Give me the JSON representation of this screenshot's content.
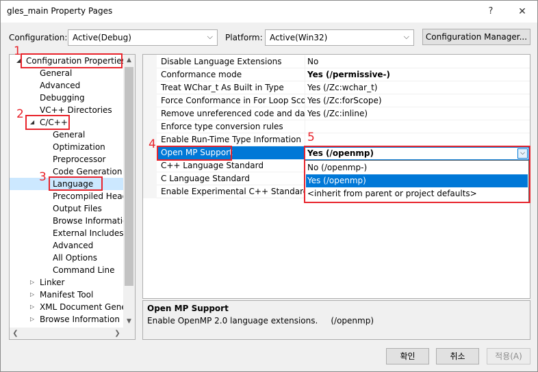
{
  "window": {
    "title": "gles_main Property Pages",
    "help": "?",
    "close": "✕"
  },
  "config_bar": {
    "configuration_label": "Configuration:",
    "configuration_value": "Active(Debug)",
    "platform_label": "Platform:",
    "platform_value": "Active(Win32)",
    "manager_button": "Configuration Manager..."
  },
  "tree": {
    "items": [
      {
        "label": "Configuration Properties",
        "level": 0,
        "expander": "expanded"
      },
      {
        "label": "General",
        "level": 1
      },
      {
        "label": "Advanced",
        "level": 1
      },
      {
        "label": "Debugging",
        "level": 1
      },
      {
        "label": "VC++ Directories",
        "level": 1
      },
      {
        "label": "C/C++",
        "level": 1,
        "expander": "expanded"
      },
      {
        "label": "General",
        "level": 2
      },
      {
        "label": "Optimization",
        "level": 2
      },
      {
        "label": "Preprocessor",
        "level": 2
      },
      {
        "label": "Code Generation",
        "level": 2
      },
      {
        "label": "Language",
        "level": 2,
        "selected": true
      },
      {
        "label": "Precompiled Heade",
        "level": 2
      },
      {
        "label": "Output Files",
        "level": 2
      },
      {
        "label": "Browse Informatior",
        "level": 2
      },
      {
        "label": "External Includes",
        "level": 2
      },
      {
        "label": "Advanced",
        "level": 2
      },
      {
        "label": "All Options",
        "level": 2
      },
      {
        "label": "Command Line",
        "level": 2
      },
      {
        "label": "Linker",
        "level": 1,
        "expander": "collapsed"
      },
      {
        "label": "Manifest Tool",
        "level": 1,
        "expander": "collapsed"
      },
      {
        "label": "XML Document Genera",
        "level": 1,
        "expander": "collapsed"
      },
      {
        "label": "Browse Information",
        "level": 1,
        "expander": "collapsed"
      }
    ]
  },
  "properties": {
    "rows": [
      {
        "name": "Disable Language Extensions",
        "value": "No",
        "bold": false
      },
      {
        "name": "Conformance mode",
        "value": "Yes (/permissive-)",
        "bold": true
      },
      {
        "name": "Treat WChar_t As Built in Type",
        "value": "Yes (/Zc:wchar_t)",
        "bold": false
      },
      {
        "name": "Force Conformance in For Loop Scope",
        "value": "Yes (/Zc:forScope)",
        "bold": false
      },
      {
        "name": "Remove unreferenced code and data",
        "value": "Yes (/Zc:inline)",
        "bold": false
      },
      {
        "name": "Enforce type conversion rules",
        "value": "",
        "bold": false
      },
      {
        "name": "Enable Run-Time Type Information",
        "value": "",
        "bold": false
      },
      {
        "name": "Open MP Support",
        "value": "",
        "bold": false,
        "selected": true
      },
      {
        "name": "C++ Language Standard",
        "value": "",
        "bold": false
      },
      {
        "name": "C Language Standard",
        "value": "",
        "bold": false
      },
      {
        "name": "Enable Experimental C++ Standard Library",
        "value": "",
        "bold": false
      }
    ],
    "dropdown_value": "Yes (/openmp)",
    "dropdown_options": [
      {
        "label": "No (/openmp-)",
        "selected": false
      },
      {
        "label": "Yes (/openmp)",
        "selected": true
      },
      {
        "label": "<inherit from parent or project defaults>",
        "selected": false
      }
    ]
  },
  "description": {
    "title": "Open MP Support",
    "text": "Enable OpenMP 2.0 language extensions.     (/openmp)"
  },
  "buttons": {
    "ok": "확인",
    "cancel": "취소",
    "apply": "적용(A)"
  },
  "annotations": [
    "1",
    "2",
    "3",
    "4",
    "5"
  ],
  "colors": {
    "annotation_red": "#e8232b",
    "selection_blue": "#0078d7",
    "tree_selection": "#cce8ff"
  }
}
